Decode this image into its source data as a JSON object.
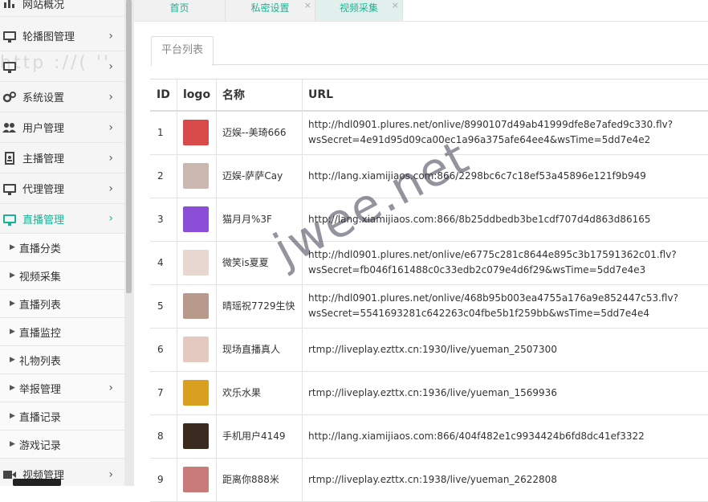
{
  "sidebar": {
    "items": [
      {
        "label": "网站概况",
        "icon": "chart-icon",
        "arrow": false
      },
      {
        "label": "轮播图管理",
        "icon": "monitor-icon",
        "arrow": true
      },
      {
        "label": "",
        "icon": "monitor-icon",
        "arrow": true
      },
      {
        "label": "系统设置",
        "icon": "gear-icon",
        "arrow": true
      },
      {
        "label": "用户管理",
        "icon": "users-icon",
        "arrow": true
      },
      {
        "label": "主播管理",
        "icon": "badge-icon",
        "arrow": true
      },
      {
        "label": "代理管理",
        "icon": "monitor-icon",
        "arrow": true
      },
      {
        "label": "直播管理",
        "icon": "monitor-icon",
        "arrow": true,
        "active": true
      }
    ],
    "sub_items": [
      {
        "label": "直播分类",
        "arrow": false
      },
      {
        "label": "视频采集",
        "arrow": false
      },
      {
        "label": "直播列表",
        "arrow": false
      },
      {
        "label": "直播监控",
        "arrow": false
      },
      {
        "label": "礼物列表",
        "arrow": false
      },
      {
        "label": "举报管理",
        "arrow": true
      },
      {
        "label": "直播记录",
        "arrow": false
      },
      {
        "label": "游戏记录",
        "arrow": false
      }
    ],
    "last_item": {
      "label": "视频管理",
      "icon": "video-icon",
      "arrow": true
    }
  },
  "tabs": [
    {
      "label": "首页",
      "closable": false
    },
    {
      "label": "私密设置",
      "closable": true
    },
    {
      "label": "视频采集",
      "closable": true,
      "active": true
    }
  ],
  "panel": {
    "tab_label": "平台列表"
  },
  "table": {
    "headers": {
      "id": "ID",
      "logo": "logo",
      "name": "名称",
      "url": "URL"
    },
    "rows": [
      {
        "id": "1",
        "name": "迈娱--美琦666",
        "url": "http://hdl0901.plures.net/onlive/8990107d49ab41999dfe8e7afed9c330.flv?\nwsSecret=4e91d95d09ca00ec1a96a375afe64ee4&wsTime=5dd7e4e2",
        "thumb": "#d94a4a"
      },
      {
        "id": "2",
        "name": "迈娱-萨萨Cay",
        "url": "http://lang.xiamijiaos.com:866/2298bc6c7c18ef53a45896e121f9b949",
        "thumb": "#c9b7b0"
      },
      {
        "id": "3",
        "name": "猫月月%3F",
        "url": "http://lang.xiamijiaos.com:866/8b25ddbedb3be1cdf707d4d863d86165",
        "thumb": "#8a4fd6"
      },
      {
        "id": "4",
        "name": "微笑is夏夏",
        "url": "http://hdl0901.plures.net/onlive/e6775c281c8644e895c3b17591362c01.flv?\nwsSecret=fb046f161488c0c33edb2c079e4d6f29&wsTime=5dd7e4e3",
        "thumb": "#e8d6d0"
      },
      {
        "id": "5",
        "name": "晴瑶祝7729生快",
        "url": "http://hdl0901.plures.net/onlive/468b95b003ea4755a176a9e852447c53.flv?\nwsSecret=5541693281c642263c04fbe5b1f259bb&wsTime=5dd7e4e4",
        "thumb": "#b89a8c"
      },
      {
        "id": "6",
        "name": "现场直播真人",
        "url": "rtmp://liveplay.ezttx.cn:1930/live/yueman_2507300",
        "thumb": "#e3c9c0"
      },
      {
        "id": "7",
        "name": "欢乐水果",
        "url": "rtmp://liveplay.ezttx.cn:1936/live/yueman_1569936",
        "thumb": "#d9a020"
      },
      {
        "id": "8",
        "name": "手机用户4149",
        "url": "http://lang.xiamijiaos.com:866/404f482e1c9934424b6fd8dc41ef3322",
        "thumb": "#3a2a20"
      },
      {
        "id": "9",
        "name": "距离你888米",
        "url": "rtmp://liveplay.ezttx.cn:1938/live/yueman_2622808",
        "thumb": "#c97a7a"
      }
    ]
  },
  "watermark": "jwee.net",
  "faded_text": "http ://(   ''"
}
